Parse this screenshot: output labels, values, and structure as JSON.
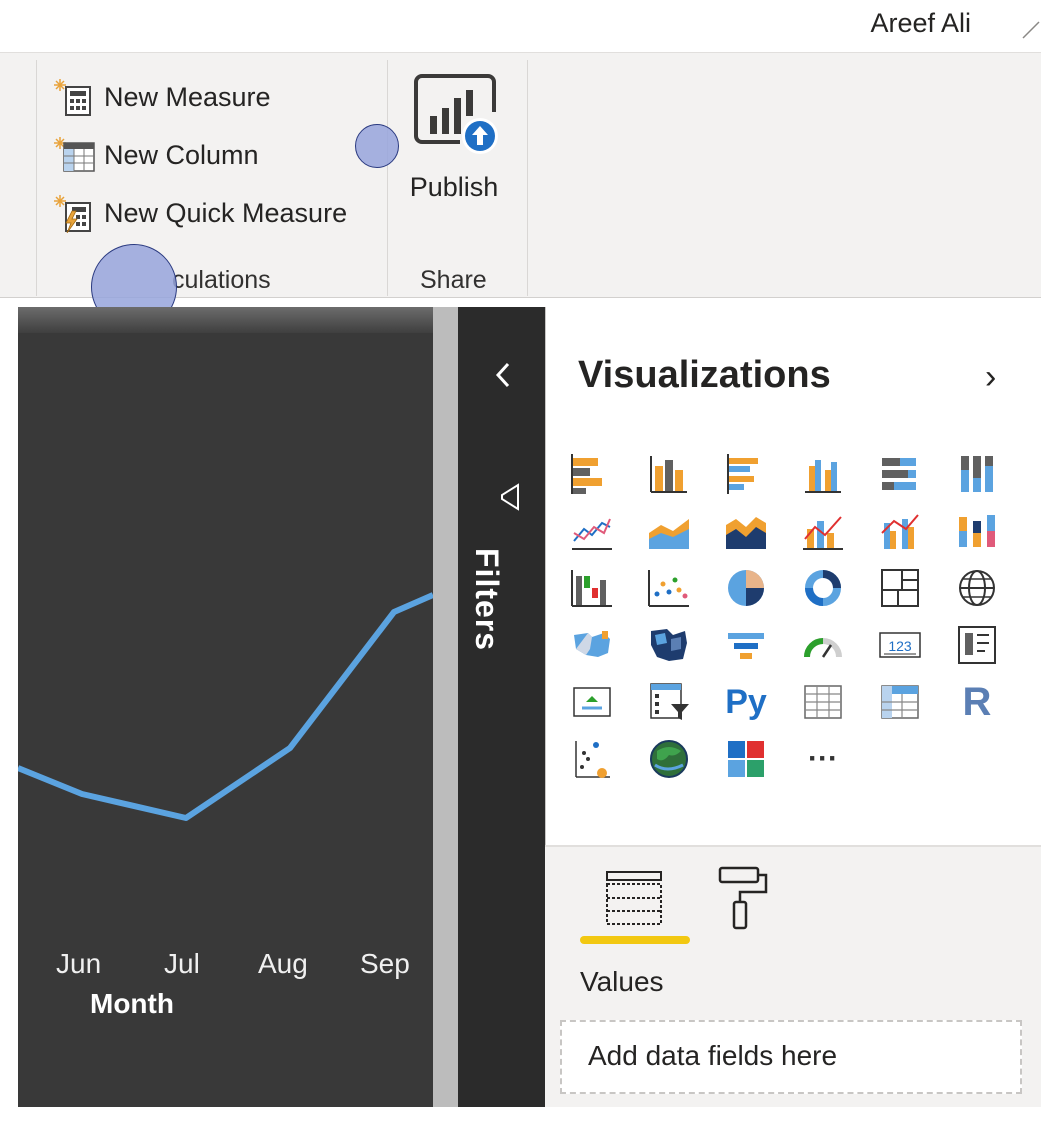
{
  "user": {
    "name": "Areef Ali"
  },
  "ribbon": {
    "calculations": {
      "label": "Calculations",
      "label_visible": "culations",
      "buttons": [
        {
          "label": "New Measure",
          "icon": "new-measure-icon"
        },
        {
          "label": "New Column",
          "icon": "new-column-icon"
        },
        {
          "label": "New Quick Measure",
          "icon": "new-quick-measure-icon"
        }
      ]
    },
    "share": {
      "label": "Share",
      "publish_label": "Publish",
      "publish_icon": "publish-icon"
    }
  },
  "chart_data": {
    "type": "line",
    "categories": [
      "Jun",
      "Jul",
      "Aug",
      "Sep"
    ],
    "xlabel": "Month",
    "line_color": "#5ba3e0"
  },
  "filters": {
    "label": "Filters",
    "collapse_icon": "chevron-left-icon",
    "filter_icon": "funnel-icon"
  },
  "visualizations": {
    "title": "Visualizations",
    "expand_icon": "chevron-right-icon",
    "icons": [
      "stacked-bar-chart-icon",
      "stacked-column-chart-icon",
      "clustered-bar-chart-icon",
      "clustered-column-chart-icon",
      "100-stacked-bar-chart-icon",
      "100-stacked-column-chart-icon",
      "line-chart-icon",
      "area-chart-icon",
      "stacked-area-chart-icon",
      "line-and-stacked-column-chart-icon",
      "line-and-clustered-column-chart-icon",
      "ribbon-chart-icon",
      "waterfall-chart-icon",
      "scatter-chart-icon",
      "pie-chart-icon",
      "donut-chart-icon",
      "treemap-icon",
      "map-icon",
      "filled-map-icon",
      "shape-map-icon",
      "funnel-icon",
      "gauge-icon",
      "card-icon",
      "multi-row-card-icon",
      "kpi-icon",
      "slicer-icon",
      "python-visual-icon",
      "table-icon",
      "matrix-icon",
      "r-visual-icon",
      "key-influencers-icon",
      "arcgis-map-icon",
      "power-apps-icon",
      "more-visuals-icon"
    ],
    "py_label": "Py",
    "r_label": "R",
    "more_label": "···",
    "card_label": "123",
    "fields_tab_icon": "fields-icon",
    "format_tab_icon": "paint-roller-icon",
    "values_label": "Values",
    "drop_placeholder": "Add data fields here",
    "accent": "#f2c811"
  }
}
